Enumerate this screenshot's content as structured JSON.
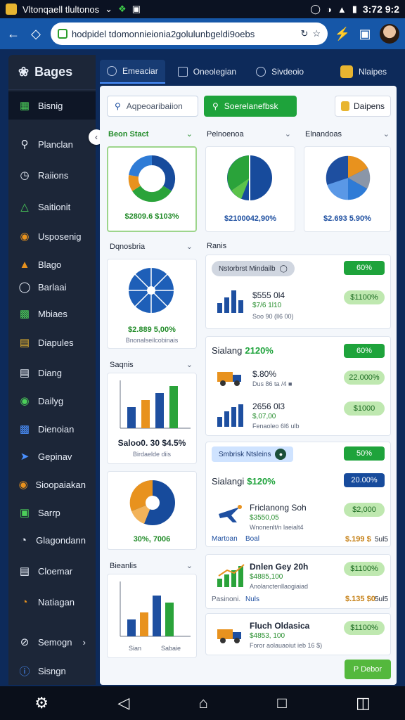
{
  "statusbar": {
    "app_title": "Vltonqaell tlultonos",
    "time": "3:72 9:2"
  },
  "browser": {
    "url": "hodpidel tdomonnieionia2golulunbgeldi9oebs"
  },
  "sidebar": {
    "brand": "Bages",
    "items": [
      {
        "label": "Bisnig",
        "icon": "building-icon"
      },
      {
        "label": "Planclan",
        "icon": "search-icon"
      },
      {
        "label": "Raiions",
        "icon": "clock-icon"
      },
      {
        "label": "Saitionit",
        "icon": "warning-icon"
      },
      {
        "label": "Usposenig",
        "icon": "pin-icon"
      },
      {
        "label": "Blago",
        "icon": "cone-icon"
      },
      {
        "label": "Barlaai",
        "icon": "chat-icon"
      },
      {
        "label": "Mbiaes",
        "icon": "map-icon"
      },
      {
        "label": "Diapules",
        "icon": "layers-icon"
      },
      {
        "label": "Diang",
        "icon": "document-icon"
      },
      {
        "label": "Dailyg",
        "icon": "globe-icon"
      },
      {
        "label": "Dienoian",
        "icon": "puzzle-icon"
      },
      {
        "label": "Gepinav",
        "icon": "send-icon"
      },
      {
        "label": "Sioopaiakan",
        "icon": "camera-icon"
      },
      {
        "label": "Sarrp",
        "icon": "box-icon"
      },
      {
        "label": "Glagondann",
        "icon": "gauge-icon"
      },
      {
        "label": "Cloemar",
        "icon": "database-icon"
      },
      {
        "label": "Natiagan",
        "icon": "chart-icon"
      },
      {
        "label": "Semogn",
        "icon": "no-icon"
      },
      {
        "label": "Sisngn",
        "icon": "info-icon"
      }
    ]
  },
  "tabs": [
    {
      "label": "Emeaciar"
    },
    {
      "label": "Oneolegian"
    },
    {
      "label": "Sivdeoio"
    },
    {
      "label": "Nlaipes"
    }
  ],
  "toolbar": {
    "input_label": "Aqpeoaribaiion",
    "primary_label": "Soerelanefbsk",
    "ghost_label": "Daipens"
  },
  "cards": {
    "col1_head": "Beon Stact",
    "col2_head": "Pelnoenoa",
    "col3_head": "Elnandoas",
    "card1_value": "$2809.6 $103%",
    "card2_value": "$2100042,90%",
    "card3_value": "$2.693 5.90%",
    "col1b_head": "Dqnosbria",
    "card4_value": "$2.889 5,00%",
    "card4_note": "Bnonalseilcobinais",
    "col1c_head": "Saqnis",
    "card5_value": "Saloo0. 30 $4.5%",
    "card5_note": "Birdaelde diis",
    "card6_value": "30%, 7006",
    "col1d_head": "Bieanlis",
    "card7_x1": "Sian",
    "card7_x2": "Sabaie"
  },
  "rows": {
    "right_head": "Ranis",
    "r1_pill": "Nstorbrst Mindailb",
    "r1_badge": "60%",
    "r1_value": "$555 0l4",
    "r1_sub": "$7/6 1l10",
    "r1_meta": "Soo 90 (ll6 00)",
    "r1_light": "$1100%",
    "r2_title": "Sialang",
    "r2_accent": "2120%",
    "r2_badge": "60%",
    "r2a_value": "$.80%",
    "r2a_meta": "Dus 86 ta /4 ■",
    "r2a_light": "22.000%",
    "r2b_value": "2656 0l3",
    "r2b_sub": "$,07,00",
    "r2b_meta": "Fenaoleo 6l6 ulb",
    "r2b_light": "$1000",
    "r3_pill": "Smbrisk Ntsleins",
    "r3_badge": "50%",
    "r3_title": "Sialangi",
    "r3_accent": "$120%",
    "r3_dark": "20.00%",
    "r3a_value": "Friclanong Soh",
    "r3a_sub": "$3550,05",
    "r3a_meta": "Wnonenlt/n laeialt4",
    "r3a_light": "$2,000",
    "r3a_link1": "Martoan",
    "r3a_link2": "Boal",
    "r3a_amt": "$.199 $",
    "r3a_tail": "5ul5",
    "r4_value": "Dnlen Gey 20h",
    "r4_sub": "$4885,100",
    "r4_meta": "Anolanctenllaogiaiad",
    "r4_light": "$1100%",
    "r4_link1": "Pasinoni.",
    "r4_link2": "Nuls",
    "r4_amt": "$.135 $0",
    "r4_tail": "5ul5",
    "r5_value": "Fluch Oldasica",
    "r5_sub": "$4853, 100",
    "r5_meta": "Foror aolauaoiut ieb 16 $)",
    "r5_light": "$1100%",
    "bottom_btn": "P Debor"
  },
  "colors": {
    "accent_green": "#1ea33b",
    "accent_blue": "#174b9c",
    "sidebar_bg": "#1c2638",
    "chart_orange": "#e8921e"
  }
}
